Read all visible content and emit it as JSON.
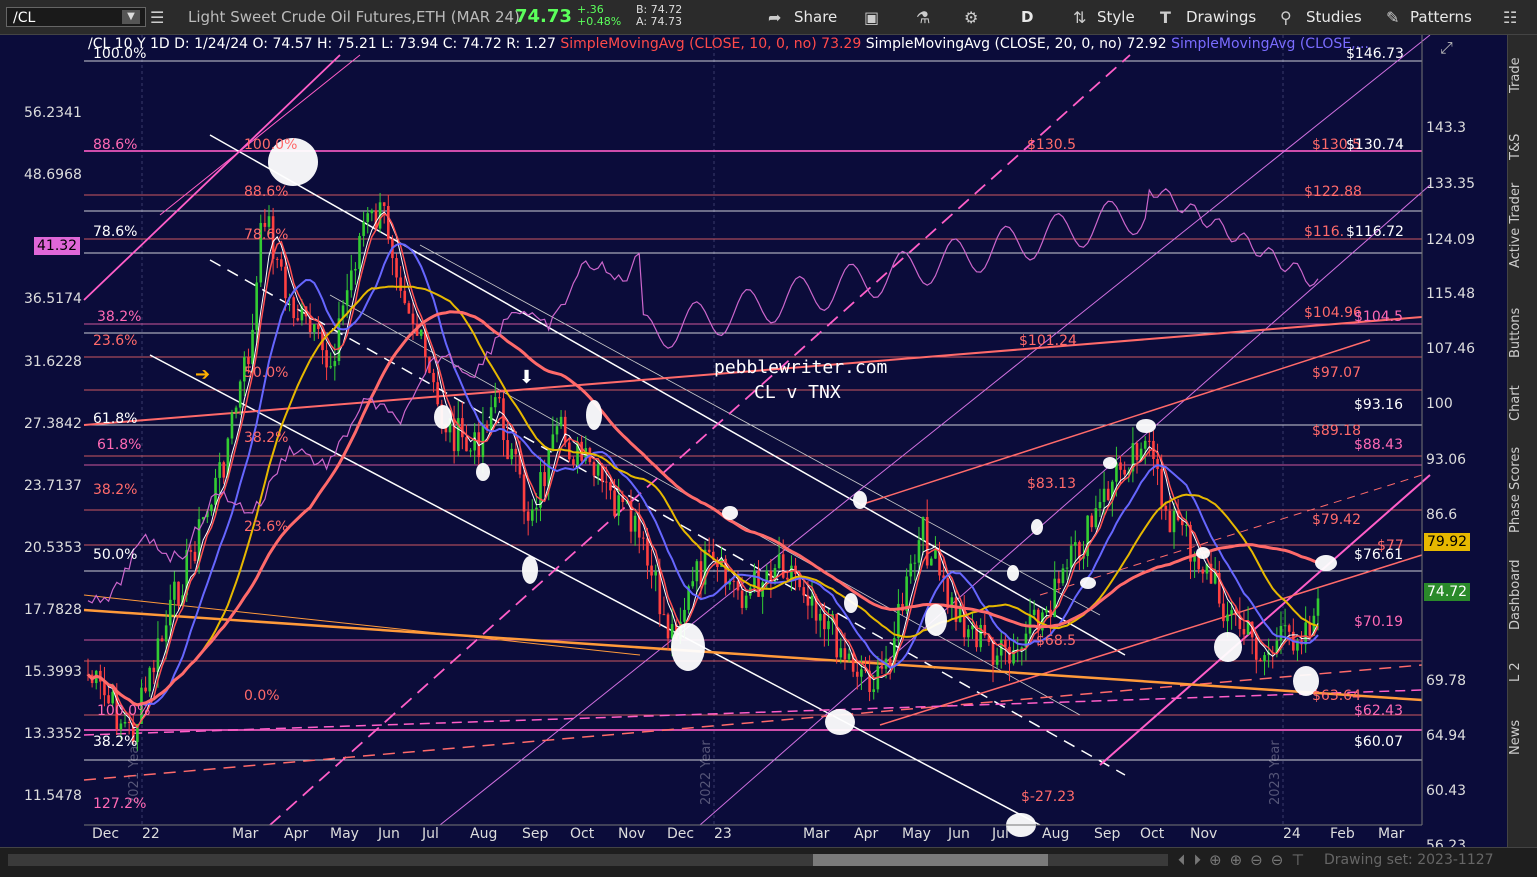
{
  "toolbar": {
    "symbol": "/CL",
    "description": "Light Sweet Crude Oil Futures,ETH (MAR 24)",
    "last": "74.73",
    "change": "+.36",
    "change_pct": "+0.48%",
    "bid": "B: 74.72",
    "ask": "A: 74.73",
    "share": "Share",
    "aggregation": "D",
    "style": "Style",
    "drawings": "Drawings",
    "studies": "Studies",
    "patterns": "Patterns"
  },
  "legend": {
    "header": "/CL 10 Y 1D",
    "date": "D: 1/24/24",
    "open": "O: 74.57",
    "high": "H: 75.21",
    "low": "L: 73.94",
    "close": "C: 74.72",
    "range": "R: 1.27",
    "sma10": "SimpleMovingAvg (CLOSE, 10, 0, no)",
    "sma10_val": "73.29",
    "sma20": "SimpleMovingAvg (CLOSE, 20, 0, no)",
    "sma20_val": "72.92",
    "sma3": "SimpleMovingAvg (CLOSE,..."
  },
  "watermark": {
    "site": "pebblewriter.com",
    "title": "CL v TNX"
  },
  "right_axis": [
    "143.3",
    "133.35",
    "124.09",
    "115.48",
    "107.46",
    "100",
    "93.06",
    "86.6",
    "69.78",
    "64.94",
    "60.43",
    "56.23"
  ],
  "left_axis": [
    "56.2341",
    "48.6968",
    "36.5174",
    "31.6228",
    "27.3842",
    "23.7137",
    "20.5353",
    "17.7828",
    "15.3993",
    "13.3352",
    "11.5478"
  ],
  "x_axis": [
    "Dec",
    "22",
    "Mar",
    "Apr",
    "May",
    "Jun",
    "Jul",
    "Aug",
    "Sep",
    "Oct",
    "Nov",
    "Dec",
    "23",
    "Mar",
    "Apr",
    "May",
    "Jun",
    "Jul",
    "Aug",
    "Sep",
    "Oct",
    "Nov",
    "24",
    "Feb",
    "Mar"
  ],
  "year_markers": [
    "2021 Year",
    "2022 Year",
    "2023 Year"
  ],
  "fib_labels_left": [
    {
      "text": "100.0%",
      "c": "#ffffff"
    },
    {
      "text": "88.6%",
      "c": "#ff69b4"
    },
    {
      "text": "78.6%",
      "c": "#ffffff"
    },
    {
      "text": "38.2%",
      "c": "#ff69b4"
    },
    {
      "text": "23.6%",
      "c": "#ff6a6a"
    },
    {
      "text": "61.8%",
      "c": "#ffffff"
    },
    {
      "text": "61.8%",
      "c": "#ff69b4"
    },
    {
      "text": "38.2%",
      "c": "#ff6a6a"
    },
    {
      "text": "50.0%",
      "c": "#ffffff"
    },
    {
      "text": "38.2%",
      "c": "#ffffff"
    },
    {
      "text": "127.2%",
      "c": "#ff69b4"
    },
    {
      "text": "100.0%",
      "c": "#ff69b4"
    }
  ],
  "fib_labels_mid": [
    {
      "text": "100.0%",
      "c": "#ff6a6a"
    },
    {
      "text": "88.6%",
      "c": "#ff6a6a"
    },
    {
      "text": "78.6%",
      "c": "#ff6a6a"
    },
    {
      "text": "50.0%",
      "c": "#ff6a6a"
    },
    {
      "text": "38.2%",
      "c": "#ff6a6a"
    },
    {
      "text": "23.6%",
      "c": "#ff6a6a"
    },
    {
      "text": "0.0%",
      "c": "#ff6a6a"
    }
  ],
  "price_labels": [
    {
      "text": "$146.73",
      "c": "#ffffff"
    },
    {
      "text": "$130.5",
      "c": "#ff6a6a"
    },
    {
      "text": "$130.5",
      "c": "#ff6a6a"
    },
    {
      "text": "$130.74",
      "c": "#ffffff"
    },
    {
      "text": "$122.88",
      "c": "#ff6a6a"
    },
    {
      "text": "$116.",
      "c": "#ff6a6a"
    },
    {
      "text": "$116.72",
      "c": "#ffffff"
    },
    {
      "text": "$104.96",
      "c": "#ff6a6a"
    },
    {
      "text": "$104.5",
      "c": "#ff69b4"
    },
    {
      "text": "$101.24",
      "c": "#ff6a6a"
    },
    {
      "text": "$97.07",
      "c": "#ff6a6a"
    },
    {
      "text": "$93.16",
      "c": "#ffffff"
    },
    {
      "text": "$89.18",
      "c": "#ff6a6a"
    },
    {
      "text": "$88.43",
      "c": "#ff69b4"
    },
    {
      "text": "$83.13",
      "c": "#ff6a6a"
    },
    {
      "text": "$79.42",
      "c": "#ff6a6a"
    },
    {
      "text": "$77",
      "c": "#ff6a6a"
    },
    {
      "text": "$76.61",
      "c": "#ffffff"
    },
    {
      "text": "$70.19",
      "c": "#ff69b4"
    },
    {
      "text": "$68.5",
      "c": "#ff6a6a"
    },
    {
      "text": "$63.64",
      "c": "#ff6a6a"
    },
    {
      "text": "$62.43",
      "c": "#ff69b4"
    },
    {
      "text": "$60.07",
      "c": "#ffffff"
    },
    {
      "text": "$-27.23",
      "c": "#ff6a6a"
    }
  ],
  "current_price_tags": {
    "last": "74.72",
    "sma": "79.92",
    "left": "41.32"
  },
  "rail_tabs": [
    "Trade",
    "T&S",
    "Active Trader",
    "Buttons",
    "Chart",
    "Phase Scores",
    "Dashboard",
    "L 2",
    "News"
  ],
  "status": {
    "drawing_set": "Drawing set: 2023-1127"
  },
  "colors": {
    "bg": "#0b0c3a",
    "up": "#33cc33",
    "down": "#ff4040",
    "sma10": "#ff5050",
    "sma20": "#ffffff",
    "sma50": "#6666ff",
    "sma100": "#e6b800",
    "sma200": "#ff6a6a",
    "tnx": "#cc66cc",
    "pink": "#ff5ec8"
  }
}
